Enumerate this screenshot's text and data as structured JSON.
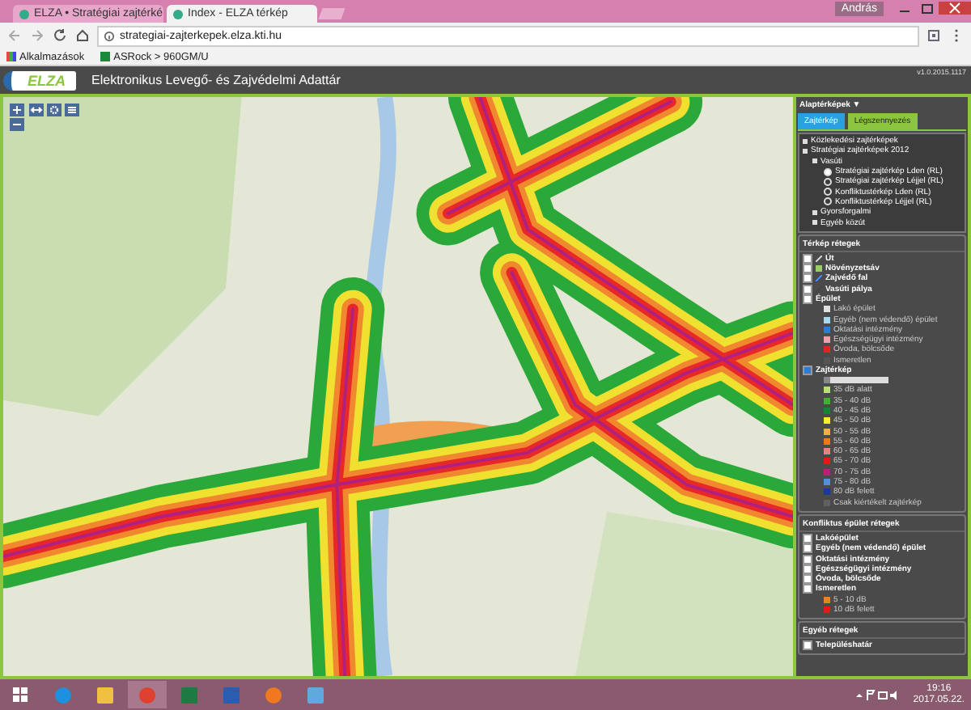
{
  "browser": {
    "tabs": [
      {
        "title": "ELZA • Stratégiai zajtérké",
        "selected": false
      },
      {
        "title": "Index - ELZA térkép",
        "selected": true
      }
    ],
    "user": "András",
    "url": "strategiai-zajterkepek.elza.kti.hu",
    "bookmarks": [
      {
        "kind": "apps",
        "label": "Alkalmazások"
      },
      {
        "kind": "site",
        "label": "ASRock > 960GM/U"
      }
    ]
  },
  "app": {
    "logo": "ELZA",
    "title": "Elektronikus Levegő- és Zajvédelmi Adattár",
    "version": "v1.0.2015.1117"
  },
  "panel": {
    "basemap_header": "Alaptérképek ▼",
    "tabs": [
      {
        "label": "Zajtérkép",
        "selected": true
      },
      {
        "label": "Légszennyezés",
        "selected": false
      }
    ],
    "tree": [
      {
        "label": "Közlekedési zajtérképek"
      },
      {
        "label": "Stratégiai zajtérképek 2012",
        "children": [
          {
            "label": "Vasúti",
            "children": [
              {
                "label": "Stratégiai zajtérkép Lden (RL)",
                "selected": true
              },
              {
                "label": "Stratégiai zajtérkép Léjjel (RL)",
                "selected": false
              },
              {
                "label": "Konfliktustérkép Lden (RL)",
                "selected": false
              },
              {
                "label": "Konfliktustérkép Léjjel (RL)",
                "selected": false
              }
            ]
          },
          {
            "label": "Gyorsforgalmi"
          },
          {
            "label": "Egyéb közút"
          }
        ]
      }
    ],
    "map_layers_header": "Térkép rétegek",
    "map_layers": [
      {
        "label": "Út",
        "checked": false,
        "kind": "road"
      },
      {
        "label": "Növényzetsáv",
        "checked": false,
        "kind": "vegetation"
      },
      {
        "label": "Zajvédő fal",
        "checked": false,
        "kind": "wall"
      },
      {
        "label": "Vasúti pálya",
        "checked": false,
        "kind": "rail"
      },
      {
        "label": "Épület",
        "checked": false,
        "kind": "none"
      }
    ],
    "building_legend": [
      {
        "label": "Lakó épület",
        "color": "#e0e0e0"
      },
      {
        "label": "Egyéb (nem védendő) épület",
        "color": "#a8d8f0"
      },
      {
        "label": "Oktatási intézmény",
        "color": "#2a7fd4"
      },
      {
        "label": "Egészségügyi intézmény",
        "color": "#f0a0a8"
      },
      {
        "label": "Óvoda, bölcsőde",
        "color": "#e82020"
      },
      {
        "label": "Ismeretlen",
        "color": "#555555"
      }
    ],
    "noise_layer": {
      "label": "Zajtérkép",
      "checked": true,
      "opacity": {
        "level": 0.1
      }
    },
    "noise_legend": [
      {
        "label": "35 dB alatt",
        "color": "#b8e070"
      },
      {
        "label": "35 - 40 dB",
        "color": "#40b030"
      },
      {
        "label": "40 - 45 dB",
        "color": "#108838"
      },
      {
        "label": "45 - 50 dB",
        "color": "#f8f020"
      },
      {
        "label": "50 - 55 dB",
        "color": "#f0b040"
      },
      {
        "label": "55 - 60 dB",
        "color": "#f07818"
      },
      {
        "label": "60 - 65 dB",
        "color": "#f08080"
      },
      {
        "label": "65 - 70 dB",
        "color": "#e81818"
      },
      {
        "label": "70 - 75 dB",
        "color": "#c81878"
      },
      {
        "label": "75 - 80 dB",
        "color": "#5090e0"
      },
      {
        "label": "80 dB felett",
        "color": "#1838a0"
      },
      {
        "label": "Csak kiértékelt zajtérkép",
        "color": "#606060"
      }
    ],
    "conflict_header": "Konfliktus épület rétegek",
    "conflict_layers": [
      {
        "label": "Lakóépület",
        "checked": false
      },
      {
        "label": "Egyéb (nem védendő) épület",
        "checked": false
      },
      {
        "label": "Oktatási intézmény",
        "checked": false
      },
      {
        "label": "Egészségügyi intézmény",
        "checked": false
      },
      {
        "label": "Óvoda, bölcsőde",
        "checked": false
      },
      {
        "label": "Ismeretlen",
        "checked": false
      }
    ],
    "conflict_legend": [
      {
        "label": "5 - 10 dB",
        "color": "#f08018"
      },
      {
        "label": "10 dB felett",
        "color": "#e81818"
      }
    ],
    "other_header": "Egyéb rétegek",
    "other_layers": [
      {
        "label": "Településhatár",
        "checked": false
      }
    ]
  },
  "taskbar": {
    "apps": [
      {
        "kind": "ie",
        "selected": false
      },
      {
        "kind": "folder",
        "selected": false
      },
      {
        "kind": "chrome",
        "selected": true
      },
      {
        "kind": "excel",
        "selected": false
      },
      {
        "kind": "word",
        "selected": false
      },
      {
        "kind": "firefox",
        "selected": false
      },
      {
        "kind": "doc",
        "selected": false
      }
    ],
    "time": "19:16",
    "date": "2017.05.22."
  }
}
